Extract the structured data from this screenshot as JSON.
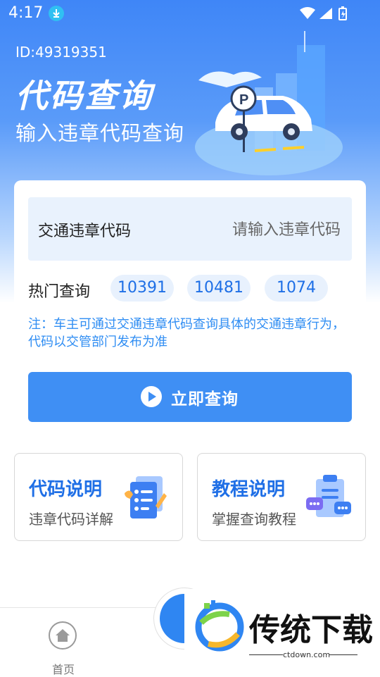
{
  "status_bar": {
    "time": "4:17",
    "icons": [
      "download-icon",
      "wifi-icon",
      "signal-icon",
      "battery-icon"
    ]
  },
  "hero": {
    "id_text": "ID:49319351",
    "title": "代码查询",
    "subtitle": "输入违章代码查询",
    "parking_sign": "P"
  },
  "search_card": {
    "input_label": "交通违章代码",
    "input_value": "",
    "input_placeholder": "请输入违章代码",
    "hot_label": "热门查询",
    "hot_codes": [
      "10391",
      "10481",
      "1074"
    ],
    "note": "注：车主可通过交通违章代码查询具体的交通违章行为，代码以交管部门发布为准",
    "query_button": "立即查询"
  },
  "features": [
    {
      "title": "代码说明",
      "subtitle": "违章代码详解",
      "icon": "document-pen-icon"
    },
    {
      "title": "教程说明",
      "subtitle": "掌握查询教程",
      "icon": "clipboard-chat-icon"
    }
  ],
  "tabbar": {
    "home_label": "首页"
  },
  "watermark": {
    "brand": "传统下载",
    "url": "ctdown.com"
  },
  "colors": {
    "primary": "#3f8ff4",
    "accent_text": "#1f6fe6",
    "note_text": "#2f8df3",
    "chip_bg": "#e8f1fd",
    "input_bg": "#e9f2fd"
  }
}
